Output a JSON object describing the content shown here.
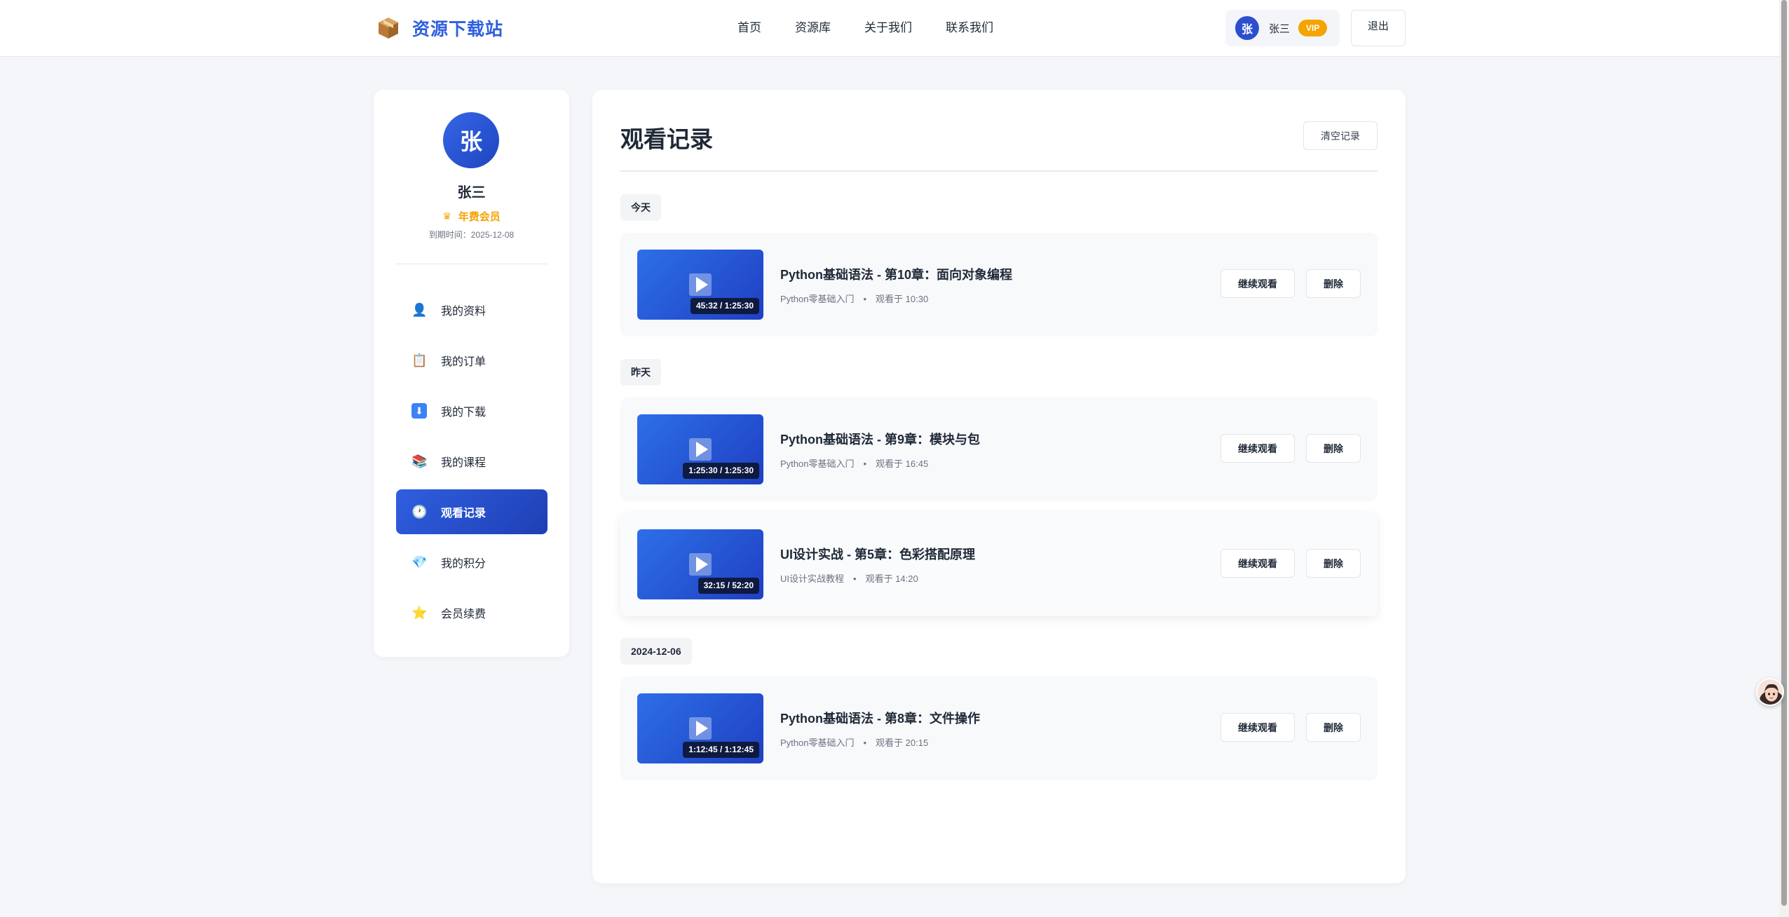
{
  "header": {
    "logo_text": "资源下载站",
    "logo_icon": "package-box-icon",
    "nav": [
      "首页",
      "资源库",
      "关于我们",
      "联系我们"
    ],
    "user": {
      "avatar_initial": "张",
      "name": "张三",
      "badge": "VIP"
    },
    "logout_label": "退出"
  },
  "sidebar": {
    "avatar_initial": "张",
    "name": "张三",
    "membership": "年费会员",
    "expiry": "到期时间：2025-12-08",
    "menu": [
      {
        "label": "我的资料",
        "icon": "👤",
        "icon_name": "user-icon"
      },
      {
        "label": "我的订单",
        "icon": "📋",
        "icon_name": "clipboard-icon"
      },
      {
        "label": "我的下载",
        "icon": "⬇",
        "icon_name": "download-icon"
      },
      {
        "label": "我的课程",
        "icon": "📚",
        "icon_name": "books-icon"
      },
      {
        "label": "观看记录",
        "icon": "🕐",
        "icon_name": "clock-icon",
        "active": true
      },
      {
        "label": "我的积分",
        "icon": "💎",
        "icon_name": "gem-icon"
      },
      {
        "label": "会员续费",
        "icon": "⭐",
        "icon_name": "star-icon"
      }
    ]
  },
  "main": {
    "title": "观看记录",
    "clear_label": "清空记录",
    "continue_label": "继续观看",
    "delete_label": "删除",
    "groups": [
      {
        "label": "今天",
        "records": [
          {
            "title": "Python基础语法 - 第10章：面向对象编程",
            "course": "Python零基础入门",
            "watched": "观看于 10:30",
            "duration": "45:32 / 1:25:30"
          }
        ]
      },
      {
        "label": "昨天",
        "records": [
          {
            "title": "Python基础语法 - 第9章：模块与包",
            "course": "Python零基础入门",
            "watched": "观看于 16:45",
            "duration": "1:25:30 / 1:25:30"
          },
          {
            "title": "UI设计实战 - 第5章：色彩搭配原理",
            "course": "UI设计实战教程",
            "watched": "观看于 14:20",
            "duration": "32:15 / 52:20"
          }
        ]
      },
      {
        "label": "2024-12-06",
        "records": [
          {
            "title": "Python基础语法 - 第8章：文件操作",
            "course": "Python零基础入门",
            "watched": "观看于 20:15",
            "duration": "1:12:45 / 1:12:45"
          }
        ]
      }
    ],
    "meta_separator": "•"
  },
  "colors": {
    "primary": "#2f5fe0",
    "vip": "#f5a300"
  }
}
